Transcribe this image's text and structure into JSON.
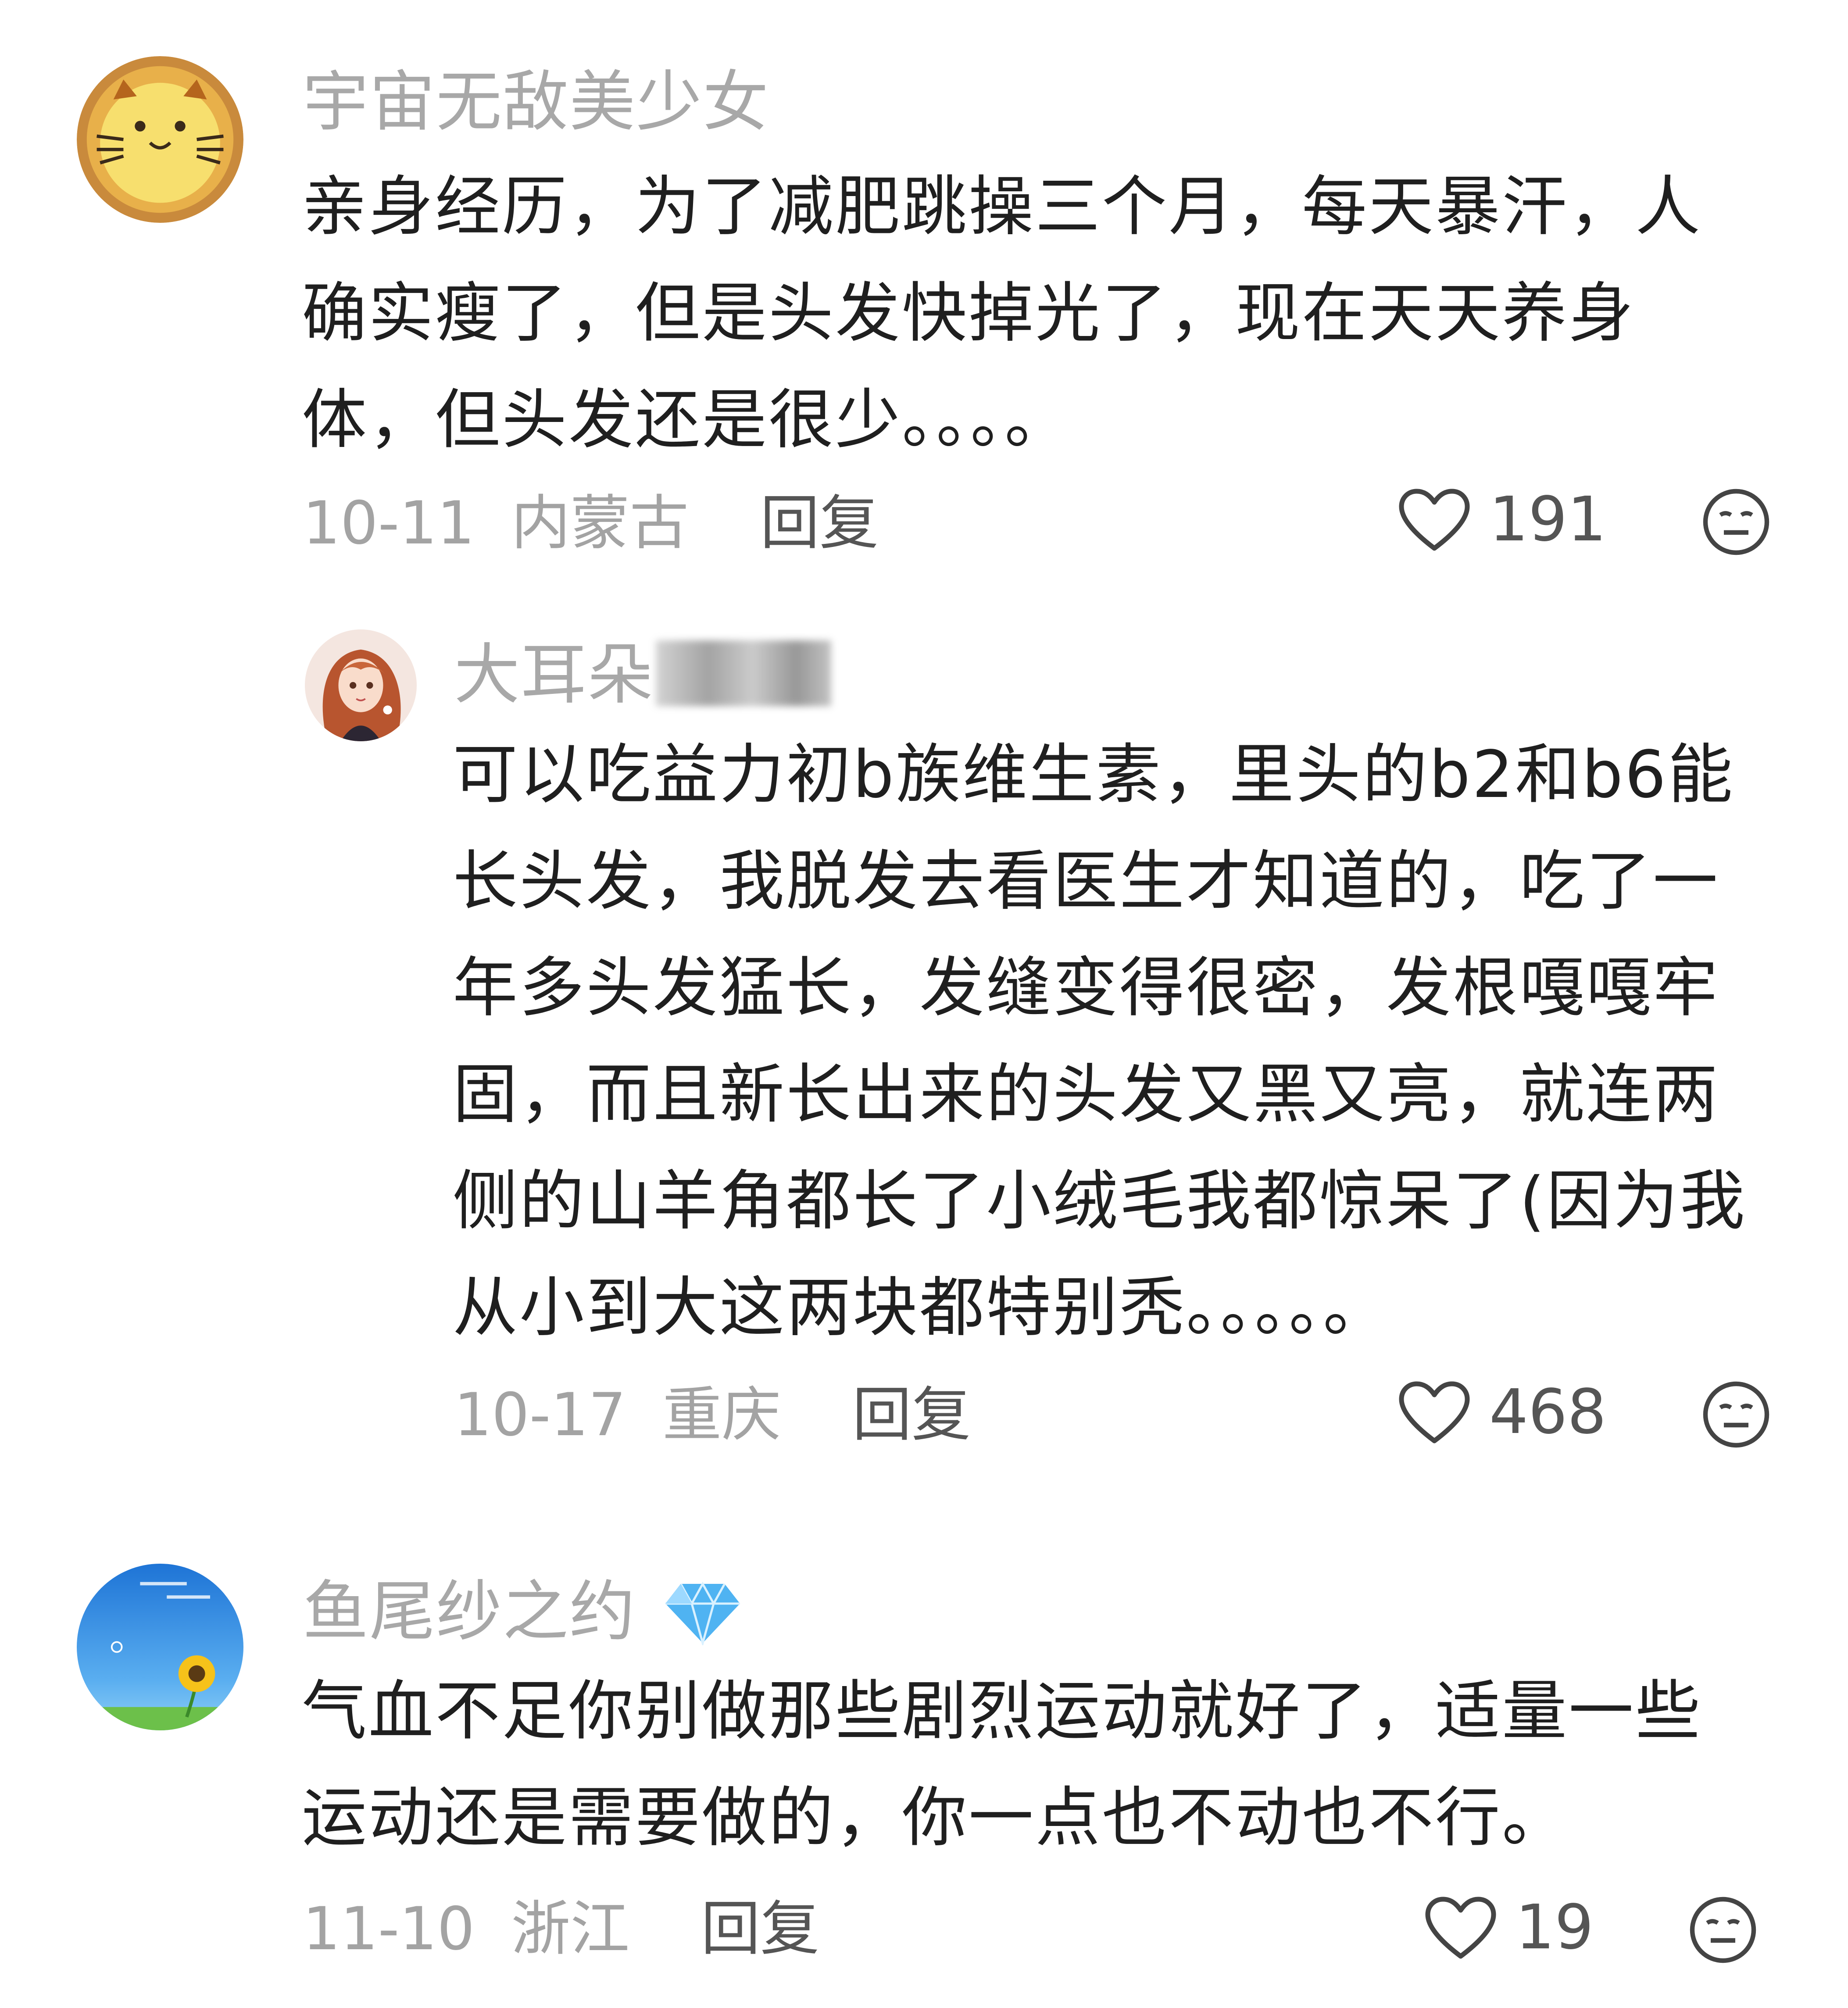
{
  "comments": [
    {
      "username": "宇宙无敌美少女",
      "content": "亲身经历，为了减肥跳操三个月，每天暴汗，人确实瘦了，但是头发快掉光了，现在天天养身体，但头发还是很少。。。。",
      "date": "10-11",
      "location": "内蒙古",
      "reply_label": "回复",
      "likes": "191",
      "avatar_icon": "cat-tart-avatar",
      "react_icon": "neutral-face-icon"
    },
    {
      "username": "大耳朵",
      "content": "可以吃益力初b族维生素，里头的b2和b6能长头发，我脱发去看医生才知道的，吃了一年多头发猛长，发缝变得很密，发根嘎嘎牢固，而且新长出来的头发又黑又亮，就连两侧的山羊角都长了小绒毛我都惊呆了(因为我从小到大这两块都特别秃。。。。。",
      "date": "10-17",
      "location": "重庆",
      "reply_label": "回复",
      "likes": "468",
      "avatar_icon": "anime-girl-avatar",
      "react_icon": "neutral-face-icon"
    },
    {
      "username": "鱼尾纱之约",
      "content": "气血不足你别做那些剧烈运动就好了，适量一些运动还是需要做的，你一点也不动也不行。",
      "date": "11-10",
      "location": "浙江",
      "reply_label": "回复",
      "likes": "19",
      "avatar_icon": "sunflower-sky-avatar",
      "badge_icon": "diamond-icon",
      "react_icon": "neutral-face-icon"
    }
  ],
  "colors": {
    "username": "#a8a8a8",
    "content": "#1f1f1f",
    "meta": "#a3a3a3",
    "reply": "#555555",
    "diamond": "#4fb3f2"
  }
}
